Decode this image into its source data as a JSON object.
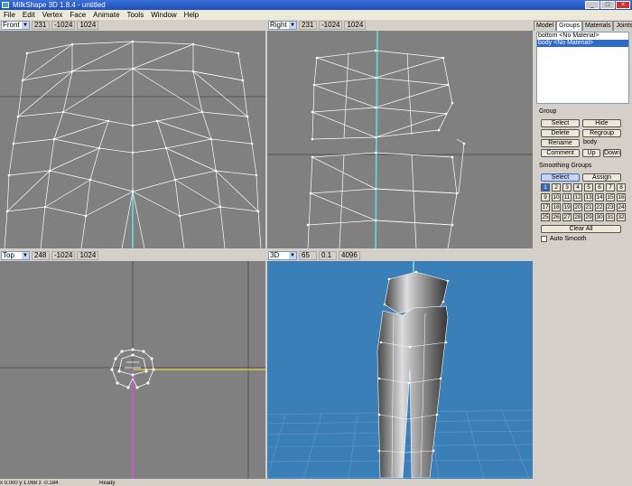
{
  "window": {
    "title": "MilkShape 3D 1.8.4 - untitled"
  },
  "menu": [
    "File",
    "Edit",
    "Vertex",
    "Face",
    "Animate",
    "Tools",
    "Window",
    "Help"
  ],
  "viewports": [
    {
      "view": "Front",
      "zoom": "231",
      "near": "-1024",
      "far": "1024"
    },
    {
      "view": "Right",
      "zoom": "231",
      "near": "-1024",
      "far": "1024"
    },
    {
      "view": "Top",
      "zoom": "248",
      "near": "-1024",
      "far": "1024"
    },
    {
      "view": "3D",
      "zoom": "65",
      "near": "0.1",
      "far": "4096"
    }
  ],
  "panel": {
    "tabs": [
      "Model",
      "Groups",
      "Materials",
      "Joints"
    ],
    "active_tab": "Groups",
    "groups": [
      {
        "label": "bottom <No Material>",
        "selected": false
      },
      {
        "label": "body <No Material>",
        "selected": true
      }
    ],
    "group_label": "Group",
    "select": "Select",
    "hide": "Hide",
    "delete": "Delete",
    "regroup": "Regroup",
    "rename": "Rename",
    "name_value": "body",
    "comment": "Comment",
    "up": "Up",
    "down": "Down",
    "smoothing_label": "Smoothing Groups",
    "sg_select": "Select",
    "sg_assign": "Assign",
    "numbers": [
      "1",
      "2",
      "3",
      "4",
      "5",
      "6",
      "7",
      "8",
      "9",
      "10",
      "11",
      "12",
      "13",
      "14",
      "15",
      "16",
      "17",
      "18",
      "19",
      "20",
      "21",
      "22",
      "23",
      "24",
      "25",
      "26",
      "27",
      "28",
      "29",
      "30",
      "31",
      "32"
    ],
    "clear_all": "Clear All",
    "auto_smooth": "Auto Smooth"
  },
  "status": {
    "coords": "x 0.000 y 1.068 z -0.184",
    "state": "Ready"
  },
  "colors": {
    "viewport_bg": "#808080",
    "view3d_bg": "#3a7fb8",
    "wire": "#ffffff",
    "selection": "#316ac5"
  }
}
